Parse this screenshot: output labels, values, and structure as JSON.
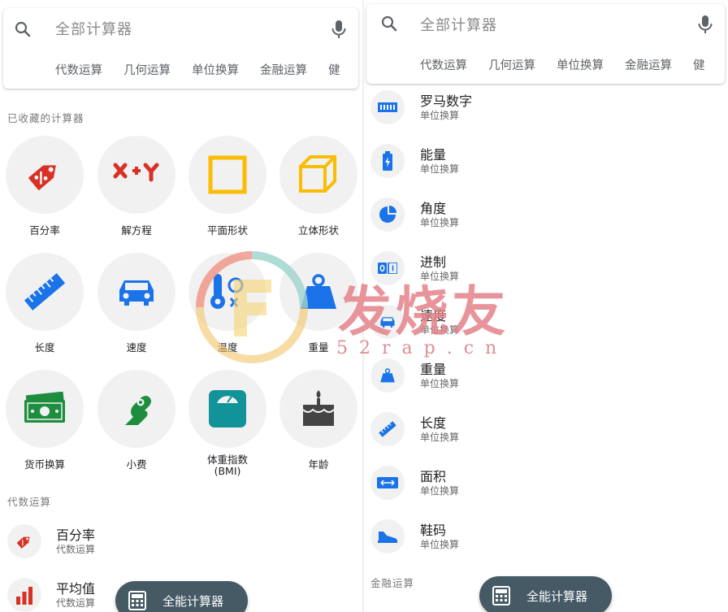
{
  "left": {
    "search": {
      "placeholder": "全部计算器",
      "icon": "search-icon",
      "mic_icon": "mic-icon"
    },
    "categories": [
      "代数运算",
      "几何运算",
      "单位换算",
      "金融运算",
      "健"
    ],
    "favorites_title": "已收藏的计算器",
    "tiles": [
      {
        "label": "百分率",
        "icon": "percent-tag-icon"
      },
      {
        "label": "解方程",
        "icon": "equation-xy-icon"
      },
      {
        "label": "平面形状",
        "icon": "square-icon"
      },
      {
        "label": "立体形状",
        "icon": "cube-icon"
      },
      {
        "label": "长度",
        "icon": "ruler-icon"
      },
      {
        "label": "速度",
        "icon": "car-icon"
      },
      {
        "label": "温度",
        "icon": "thermometer-icon"
      },
      {
        "label": "重量",
        "icon": "weight-icon"
      },
      {
        "label": "货币换算",
        "icon": "banknote-icon"
      },
      {
        "label": "小费",
        "icon": "tip-hand-icon"
      },
      {
        "label": "体重指数\n(BMI)",
        "icon": "scale-icon"
      },
      {
        "label": "年龄",
        "icon": "cake-icon"
      }
    ],
    "algebra_title": "代数运算",
    "list": [
      {
        "title": "百分率",
        "subtitle": "代数运算",
        "icon": "percent-tag-icon"
      },
      {
        "title": "平均值",
        "subtitle": "代数运算",
        "icon": "bar-chart-icon"
      }
    ],
    "fab_label": "全能计算器"
  },
  "right": {
    "search": {
      "placeholder": "全部计算器",
      "icon": "search-icon",
      "mic_icon": "mic-icon"
    },
    "categories": [
      "代数运算",
      "几何运算",
      "单位换算",
      "金融运算",
      "健"
    ],
    "list": [
      {
        "title": "罗马数字",
        "subtitle": "单位换算",
        "icon": "roman-numeral-icon"
      },
      {
        "title": "能量",
        "subtitle": "单位换算",
        "icon": "battery-icon"
      },
      {
        "title": "角度",
        "subtitle": "单位换算",
        "icon": "pie-icon"
      },
      {
        "title": "进制",
        "subtitle": "单位换算",
        "icon": "binary-icon"
      },
      {
        "title": "速度",
        "subtitle": "单位换算",
        "icon": "car-icon"
      },
      {
        "title": "重量",
        "subtitle": "单位换算",
        "icon": "weight-icon"
      },
      {
        "title": "长度",
        "subtitle": "单位换算",
        "icon": "ruler-icon"
      },
      {
        "title": "面积",
        "subtitle": "单位换算",
        "icon": "area-icon"
      },
      {
        "title": "鞋码",
        "subtitle": "单位换算",
        "icon": "shoe-icon"
      }
    ],
    "finance_title": "金融运算",
    "fab_label": "全能计算器"
  },
  "watermark": {
    "text": "发烧友",
    "sub": "52rap.cn"
  },
  "colors": {
    "blue": "#1a73e8",
    "red": "#d93025",
    "yellow": "#fbbc04",
    "green": "#1e8e3e",
    "teal": "#12939a",
    "gray_bg": "#f1f1f1",
    "fab": "#455a64"
  }
}
